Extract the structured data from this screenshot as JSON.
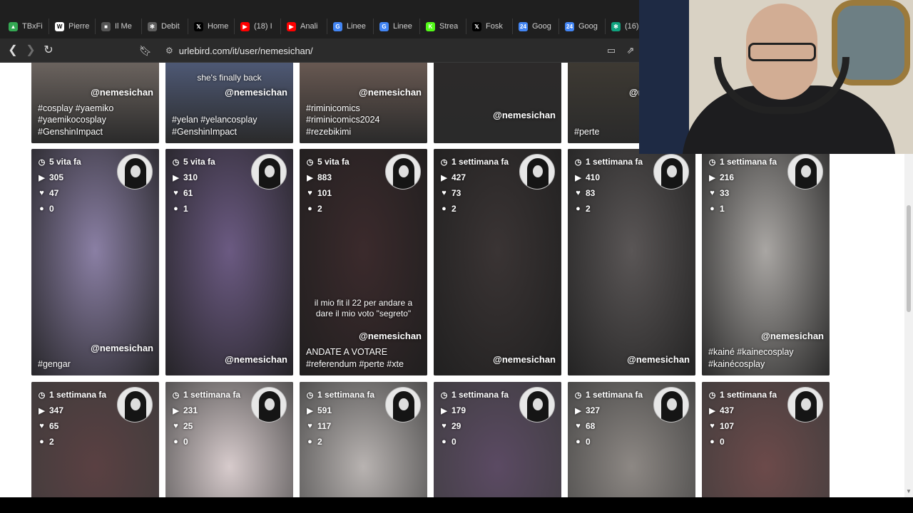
{
  "browser": {
    "tabs": [
      {
        "label": "TBxFi",
        "icon": "google-drive-icon",
        "color": "#34a853",
        "glyph": "▲"
      },
      {
        "label": "Pierre",
        "icon": "wikipedia-icon",
        "color": "#ffffff",
        "glyph": "W"
      },
      {
        "label": "Il Me",
        "icon": "site-icon",
        "color": "#555555",
        "glyph": "■"
      },
      {
        "label": "Debit",
        "icon": "chatgpt-icon",
        "color": "#5f5f5f",
        "glyph": "✻"
      },
      {
        "label": "Home",
        "icon": "x-icon",
        "color": "#000000",
        "glyph": "𝕏"
      },
      {
        "label": "(18) I",
        "icon": "youtube-icon",
        "color": "#ff0000",
        "glyph": "▶"
      },
      {
        "label": "Anali",
        "icon": "youtube-icon",
        "color": "#ff0000",
        "glyph": "▶"
      },
      {
        "label": "Linee",
        "icon": "google-icon",
        "color": "#4285f4",
        "glyph": "G"
      },
      {
        "label": "Linee",
        "icon": "google-icon",
        "color": "#4285f4",
        "glyph": "G"
      },
      {
        "label": "Strea",
        "icon": "kick-icon",
        "color": "#53fc18",
        "glyph": "K"
      },
      {
        "label": "Fosk",
        "icon": "x-icon",
        "color": "#000000",
        "glyph": "𝕏"
      },
      {
        "label": "Goog",
        "icon": "google-calendar-icon",
        "color": "#4285f4",
        "glyph": "24"
      },
      {
        "label": "Goog",
        "icon": "google-calendar-icon",
        "color": "#4285f4",
        "glyph": "24"
      },
      {
        "label": "(16)",
        "icon": "chatgpt-icon",
        "color": "#10a37f",
        "glyph": "✻"
      }
    ],
    "url": "urlebird.com/it/user/nemesichan/"
  },
  "handle": "@nemesichan",
  "top_row": [
    {
      "handle": "@nemesichan",
      "caption": [
        "#cosplay #yaemiko",
        "#yaemikocosplay",
        "#GenshinImpact"
      ],
      "overlay": "",
      "color": "#6d6560"
    },
    {
      "handle": "@nemesichan",
      "caption": [
        "#yelan #yelancosplay",
        "#GenshinImpact"
      ],
      "overlay": "she's finally back",
      "color": "#4f5a77"
    },
    {
      "handle": "@nemesichan",
      "caption": [
        "#riminicomics",
        "#riminicomics2024",
        "#rezebikimi"
      ],
      "overlay": "",
      "color": "#6a5a53"
    },
    {
      "handle": "@nemesichan",
      "caption": [],
      "overlay": "",
      "color": "#2c2a2a"
    },
    {
      "handle": "@ne",
      "caption": [
        "#perte"
      ],
      "overlay": "",
      "color": "#3e3a33"
    }
  ],
  "middle_row": [
    {
      "time": "5 vita fa",
      "views": "305",
      "likes": "47",
      "comments": "0",
      "handle": "@nemesichan",
      "caption": [
        "#gengar"
      ],
      "overlay": [],
      "color": "#8a7fa4"
    },
    {
      "time": "5 vita fa",
      "views": "310",
      "likes": "61",
      "comments": "1",
      "handle": "@nemesichan",
      "caption": [],
      "overlay": [],
      "color": "#6b5a82"
    },
    {
      "time": "5 vita fa",
      "views": "883",
      "likes": "101",
      "comments": "2",
      "handle": "@nemesichan",
      "caption": [
        "ANDATE A VOTARE",
        "#referendum #perte #xte"
      ],
      "overlay": [
        "il mio fit il 22 per andare a",
        "dare il mio voto \"segreto\""
      ],
      "color": "#3b2a2c"
    },
    {
      "time": "1 settimana fa",
      "views": "427",
      "likes": "73",
      "comments": "2",
      "handle": "@nemesichan",
      "caption": [],
      "overlay": [],
      "color": "#3a3434"
    },
    {
      "time": "1 settimana fa",
      "views": "410",
      "likes": "83",
      "comments": "2",
      "handle": "@nemesichan",
      "caption": [],
      "overlay": [],
      "color": "#5a5656"
    },
    {
      "time": "1 settimana fa",
      "views": "216",
      "likes": "33",
      "comments": "1",
      "handle": "@nemesichan",
      "caption": [
        "#kainé #kainecosplay",
        "#kainécosplay"
      ],
      "overlay": [],
      "color": "#a9a6a3"
    }
  ],
  "bottom_row": [
    {
      "time": "1 settimana fa",
      "views": "347",
      "likes": "65",
      "comments": "2",
      "color": "#5a4042"
    },
    {
      "time": "1 settimana fa",
      "views": "231",
      "likes": "25",
      "comments": "0",
      "color": "#d7cbcc"
    },
    {
      "time": "1 settimana fa",
      "views": "591",
      "likes": "117",
      "comments": "2",
      "color": "#b8b3b1"
    },
    {
      "time": "1 settimana fa",
      "views": "179",
      "likes": "29",
      "comments": "0",
      "color": "#5b4a63"
    },
    {
      "time": "1 settimana fa",
      "views": "327",
      "likes": "68",
      "comments": "0",
      "color": "#8d8884"
    },
    {
      "time": "1 settimana fa",
      "views": "437",
      "likes": "107",
      "comments": "0",
      "color": "#6c4a4a"
    }
  ]
}
